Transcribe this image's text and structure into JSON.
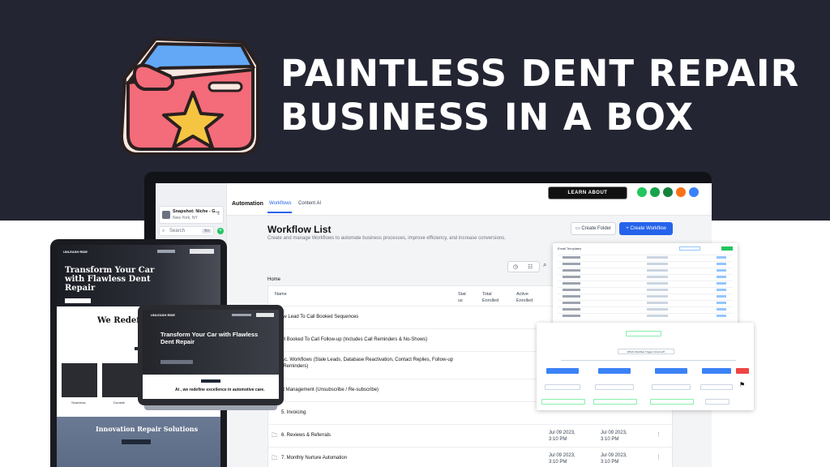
{
  "headline": {
    "line1": "PAINTLESS DENT REPAIR",
    "line2": "BUSINESS IN A BOX"
  },
  "colors": {
    "banner": "#232532",
    "accent": "#2563eb",
    "box_red": "#f46b7a",
    "box_blue": "#60a5fa",
    "star": "#f5c542"
  },
  "sidebar": {
    "location_name": "Snapshot: Niche - G...",
    "location_city": "New York, NY",
    "search_placeholder": "Search",
    "search_shortcut": "⌘K"
  },
  "topbar": {
    "section_title": "Automation",
    "tabs": [
      {
        "label": "Workflows"
      },
      {
        "label": "Content AI"
      }
    ],
    "learn_button": "LEARN ABOUT WORKFLOWS"
  },
  "page": {
    "title": "Workflow List",
    "subtitle": "Create and manage Workflows to automate business processes, improve efficiency, and increase conversions.",
    "create_folder": "Create Folder",
    "create_workflow": "+ Create Workflow",
    "breadcrumb": "Home"
  },
  "table": {
    "headers": {
      "name": "Name",
      "status": "Stat us",
      "total": "Total Enrolled",
      "active": "Active Enrolled"
    },
    "rows": [
      {
        "name": "1. New Lead To Call Booked Sequences",
        "d1": "",
        "d2": ""
      },
      {
        "name": "2. Call Booked To Call Follow-up (Includes Call Reminders & No-Shows)",
        "d1": "",
        "d2": ""
      },
      {
        "name": "3. Misc. Workflows (Stale Leads, Database Reactivation, Contact Replies, Follow-up Date Reminders)",
        "d1": "",
        "d2": ""
      },
      {
        "name": "4. List Management (Unsubscribe / Re-subscribe)",
        "d1": "",
        "d2": ""
      },
      {
        "name": "5. Invoicing",
        "d1": "",
        "d2": ""
      },
      {
        "name": "6. Reviews & Referrals",
        "d1": "Jul 09 2023, 3:10 PM",
        "d2": "Jul 09 2023, 3:10 PM"
      },
      {
        "name": "7. Monthly Nurture Automation",
        "d1": "Jul 09 2023, 3:10 PM",
        "d2": "Jul 09 2023, 3:10 PM"
      }
    ]
  },
  "tablet": {
    "hero_title": "Transform Your Car with Flawless Dent Repair",
    "section_title": "We Redefine Automo",
    "captions": [
      "Seamless",
      "Durable"
    ],
    "innovation_title": "Innovation Repair Solutions"
  },
  "mini_laptop": {
    "logo": "UNLEASH RIDE",
    "hero_title": "Transform Your Car with Flawless Dent Repair",
    "tagline": "At , we redefine excellence in automotive care."
  },
  "overlay": {
    "email_title": "Email Templates",
    "trigger_question": "Which Workflow Trigger Occurred?"
  }
}
